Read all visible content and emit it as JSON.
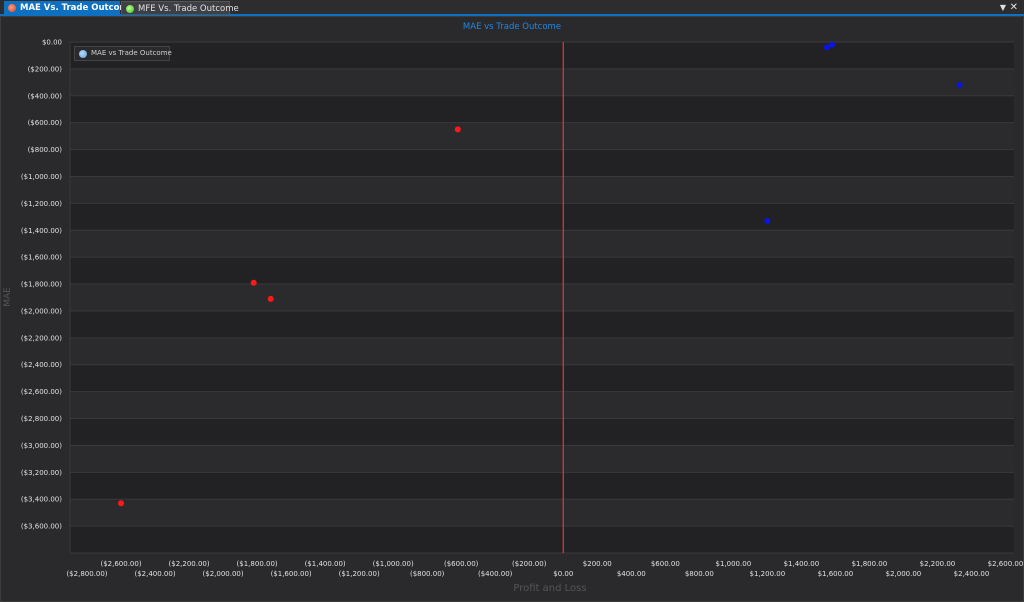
{
  "tabs": [
    {
      "label": "MAE Vs. Trade Outcome"
    },
    {
      "label": "MFE Vs. Trade Outcome"
    }
  ],
  "tab_menu_icon": "chevron-down-icon",
  "tab_close_icon": "close-icon",
  "chart_data": {
    "type": "scatter",
    "title": "MAE vs Trade Outcome",
    "xlabel": "Profit and Loss",
    "ylabel": "MAE",
    "legend": {
      "entry": "MAE vs Trade Outcome",
      "placement": "top-left"
    },
    "xlim": [
      -2900,
      2650
    ],
    "ylim": [
      -3800,
      0
    ],
    "grid": true,
    "zero_line": {
      "x": 0,
      "color": "#e53935"
    },
    "y_ticks": [
      {
        "value": 0,
        "label": "$0.00"
      },
      {
        "value": -200,
        "label": "($200.00)"
      },
      {
        "value": -400,
        "label": "($400.00)"
      },
      {
        "value": -600,
        "label": "($600.00)"
      },
      {
        "value": -800,
        "label": "($800.00)"
      },
      {
        "value": -1000,
        "label": "($1,000.00)"
      },
      {
        "value": -1200,
        "label": "($1,200.00)"
      },
      {
        "value": -1400,
        "label": "($1,400.00)"
      },
      {
        "value": -1600,
        "label": "($1,600.00)"
      },
      {
        "value": -1800,
        "label": "($1,800.00)"
      },
      {
        "value": -2000,
        "label": "($2,000.00)"
      },
      {
        "value": -2200,
        "label": "($2,200.00)"
      },
      {
        "value": -2400,
        "label": "($2,400.00)"
      },
      {
        "value": -2600,
        "label": "($2,600.00)"
      },
      {
        "value": -2800,
        "label": "($2,800.00)"
      },
      {
        "value": -3000,
        "label": "($3,000.00)"
      },
      {
        "value": -3200,
        "label": "($3,200.00)"
      },
      {
        "value": -3400,
        "label": "($3,400.00)"
      },
      {
        "value": -3600,
        "label": "($3,600.00)"
      }
    ],
    "x_ticks": [
      {
        "value": -2800,
        "label": "($2,800.00)",
        "row": 2
      },
      {
        "value": -2600,
        "label": "($2,600.00)",
        "row": 1
      },
      {
        "value": -2400,
        "label": "($2,400.00)",
        "row": 2
      },
      {
        "value": -2200,
        "label": "($2,200.00)",
        "row": 1
      },
      {
        "value": -2000,
        "label": "($2,000.00)",
        "row": 2
      },
      {
        "value": -1800,
        "label": "($1,800.00)",
        "row": 1
      },
      {
        "value": -1600,
        "label": "($1,600.00)",
        "row": 2
      },
      {
        "value": -1400,
        "label": "($1,400.00)",
        "row": 1
      },
      {
        "value": -1200,
        "label": "($1,200.00)",
        "row": 2
      },
      {
        "value": -1000,
        "label": "($1,000.00)",
        "row": 1
      },
      {
        "value": -800,
        "label": "($800.00)",
        "row": 2
      },
      {
        "value": -600,
        "label": "($600.00)",
        "row": 1
      },
      {
        "value": -400,
        "label": "($400.00)",
        "row": 2
      },
      {
        "value": -200,
        "label": "($200.00)",
        "row": 1
      },
      {
        "value": 0,
        "label": "$0.00",
        "row": 2
      },
      {
        "value": 200,
        "label": "$200.00",
        "row": 1
      },
      {
        "value": 400,
        "label": "$400.00",
        "row": 2
      },
      {
        "value": 600,
        "label": "$600.00",
        "row": 1
      },
      {
        "value": 800,
        "label": "$800.00",
        "row": 2
      },
      {
        "value": 1000,
        "label": "$1,000.00",
        "row": 1
      },
      {
        "value": 1200,
        "label": "$1,200.00",
        "row": 2
      },
      {
        "value": 1400,
        "label": "$1,400.00",
        "row": 1
      },
      {
        "value": 1600,
        "label": "$1,600.00",
        "row": 2
      },
      {
        "value": 1800,
        "label": "$1,800.00",
        "row": 1
      },
      {
        "value": 2000,
        "label": "$2,000.00",
        "row": 2
      },
      {
        "value": 2200,
        "label": "$2,200.00",
        "row": 1
      },
      {
        "value": 2400,
        "label": "$2,400.00",
        "row": 2
      },
      {
        "value": 2600,
        "label": "$2,600.00",
        "row": 1
      }
    ],
    "points": [
      {
        "x": -2600,
        "y": -3430,
        "color": "#ff1a1a"
      },
      {
        "x": -1820,
        "y": -1790,
        "color": "#ff1a1a"
      },
      {
        "x": -1720,
        "y": -1910,
        "color": "#ff1a1a"
      },
      {
        "x": -620,
        "y": -650,
        "color": "#ff1a1a"
      },
      {
        "x": 1200,
        "y": -1330,
        "color": "#0a14e6"
      },
      {
        "x": 1550,
        "y": -40,
        "color": "#0a14e6"
      },
      {
        "x": 1580,
        "y": -20,
        "color": "#0a14e6"
      },
      {
        "x": 2330,
        "y": -320,
        "color": "#0a14e6"
      }
    ]
  }
}
